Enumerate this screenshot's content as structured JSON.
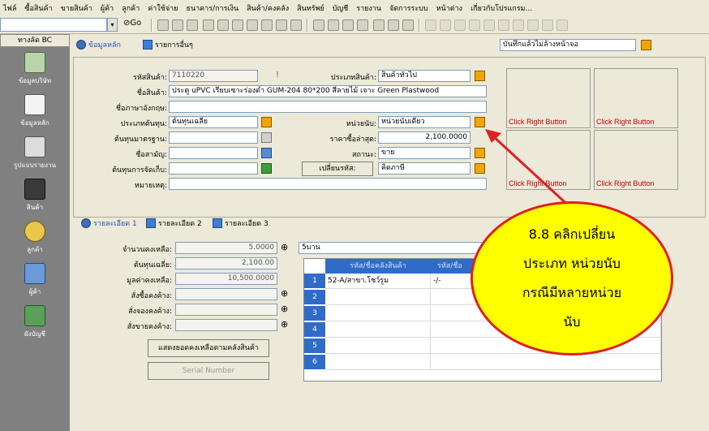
{
  "menubar": [
    "ไฟล์",
    "ซื้อสินค้า",
    "ขายสินค้า",
    "ผู้ค้า",
    "ลูกค้า",
    "ค่าใช้จ่าย",
    "ธนาคาร/การเงิน",
    "สินค้า/คงคลัง",
    "สินทรัพย์",
    "บัญชี",
    "รายงาน",
    "จัดการระบบ",
    "หน้าต่าง",
    "เกี่ยวกับโปรแกรม..."
  ],
  "toolbar": {
    "go_label": "Go"
  },
  "sidebar": {
    "header": "ทางลัด BC",
    "items": [
      {
        "label": "ข้อมูลบริษัท"
      },
      {
        "label": "ข้อมูลหลัก"
      },
      {
        "label": "รูปแบบรายงาน"
      },
      {
        "label": "สินค้า"
      },
      {
        "label": "ลูกค้า"
      },
      {
        "label": "ผู้ค้า"
      },
      {
        "label": "ผังบัญชี"
      }
    ]
  },
  "tabs_top": {
    "main": "ข้อมูลหลัก",
    "other": "รายการอื่นๆ"
  },
  "save_mode": "บันทึกแล้วไม่ล้างหน้าจอ",
  "form": {
    "code_label": "รหัสสินค้า:",
    "code_value": "7110220",
    "type_label": "ประเภทสินค้า:",
    "type_value": "สินค้าทั่วไป",
    "name_label": "ชื่อสินค้า:",
    "name_value": "ประตู uPVC เรียบเซาะร่องดำ GUM-204 80*200 สีลายไม้ เจาะ Green Plastwood",
    "eng_label": "ชื่อภาษาอังกฤษ:",
    "eng_value": "",
    "costtype_label": "ประเภทต้นทุน:",
    "costtype_value": "ต้นทุนเฉลี่ย",
    "unit_label": "หน่วยนับ:",
    "unit_value": "หน่วยนับเดียว",
    "stdcost_label": "ต้นทุนมาตรฐาน:",
    "stdcost_value": "",
    "lastbuy_label": "ราคาซื้อล่าสุด:",
    "lastbuy_value": "2,100.0000",
    "short_label": "ชื่อสามัญ:",
    "short_value": "",
    "status_label": "สถานะ:",
    "status_value": "ขาย",
    "storecost_label": "ต้นทุนการจัดเก็บ:",
    "storecost_value": "",
    "change_code_button": "เปลี่ยนรหัส:",
    "change_code_value": "คิดภาษี",
    "note_label": "หมายเหตุ:",
    "note_value": ""
  },
  "images": [
    "Click Right Button",
    "Click Right Button",
    "Click Right Button",
    "Click Right Button"
  ],
  "tabs_detail": [
    "รายละเอียด 1",
    "รายละเอียด 2",
    "รายละเอียด 3"
  ],
  "detail": {
    "qty_label": "จำนวนคงเหลือ:",
    "qty_value": "5.0000",
    "avgcost_label": "ต้นทุนเฉลี่ย:",
    "avgcost_value": "2,100.00",
    "stockval_label": "มูลค่าคงเหลือ:",
    "stockval_value": "10,500.0000",
    "po_label": "สั่งซื้อคงค้าง:",
    "po_value": "",
    "reserve_label": "สั่งจองคงค้าง:",
    "reserve_value": "",
    "so_label": "สั่งขายคงค้าง:",
    "so_value": "",
    "show_stock_button": "แสดงยอดคงเหลือตามคลังสินค้า",
    "serial_button": "Serial Number",
    "unit_combo": "5บาน"
  },
  "grid": {
    "headers": [
      "รหัส/ชื่อคลังสินค้า",
      "รหัส/ชื่อ"
    ],
    "rows": [
      {
        "num": "1",
        "c1": "52-A/สาขา.โชว์รูม",
        "c2": "-/-"
      },
      {
        "num": "2",
        "c1": "",
        "c2": ""
      },
      {
        "num": "3",
        "c1": "",
        "c2": ""
      },
      {
        "num": "4",
        "c1": "",
        "c2": ""
      },
      {
        "num": "5",
        "c1": "",
        "c2": ""
      },
      {
        "num": "6",
        "c1": "",
        "c2": ""
      }
    ]
  },
  "callout": {
    "lines": [
      "8.8 คลิกเปลี่ยน",
      "ประเภท หน่วยนับ",
      "กรณีมีหลายหน่วย",
      "นับ"
    ],
    "fill_color": "#ffff00",
    "border_color": "#e02020"
  }
}
